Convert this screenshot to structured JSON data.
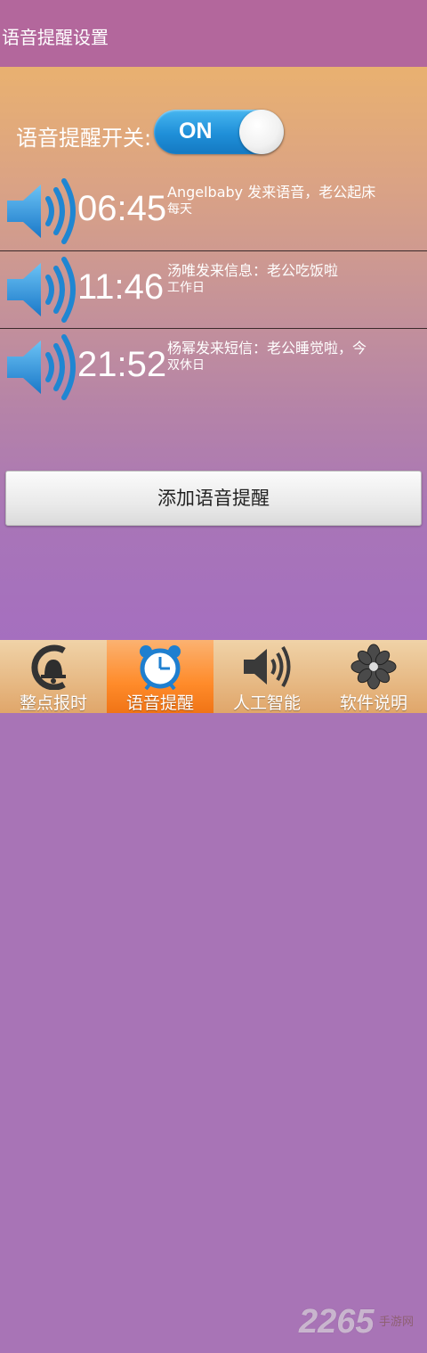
{
  "header": {
    "title": "语音提醒设置"
  },
  "voice_switch": {
    "label": "语音提醒开关:",
    "state": "ON"
  },
  "reminders": [
    {
      "time": "06:45",
      "message": "Angelbaby 发来语音，老公起床",
      "repeat": "每天"
    },
    {
      "time": "11:46",
      "message": "汤唯发来信息：老公吃饭啦",
      "repeat": "工作日"
    },
    {
      "time": "21:52",
      "message": "杨幂发来短信：老公睡觉啦，今",
      "repeat": "双休日"
    }
  ],
  "add_button": {
    "label": "添加语音提醒"
  },
  "tabs": [
    {
      "label": "整点报时",
      "icon": "bell-clock-icon",
      "active": false
    },
    {
      "label": "语音提醒",
      "icon": "alarm-clock-icon",
      "active": true
    },
    {
      "label": "人工智能",
      "icon": "speaker-icon",
      "active": false
    },
    {
      "label": "软件说明",
      "icon": "flower-icon",
      "active": false
    }
  ],
  "watermark": {
    "number": "2265",
    "text": "手游网"
  },
  "colors": {
    "titlebar": "#b3679c",
    "toggle": "#1f8fd8",
    "speaker": "#2a8fd8",
    "active_tab": "#ff8b2a"
  }
}
